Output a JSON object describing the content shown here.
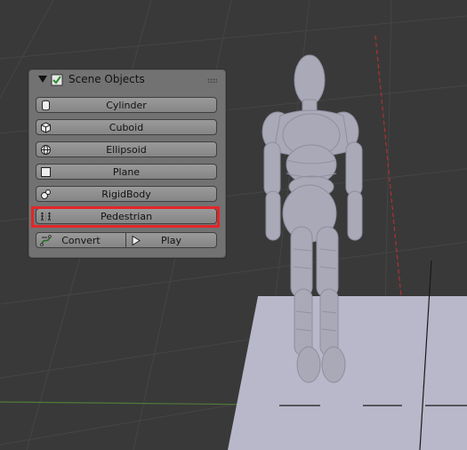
{
  "panel": {
    "title": "Scene Objects",
    "icons": {
      "header": "checkbox-tick-icon",
      "grip": "grip-dots-icon"
    },
    "items": [
      {
        "label": "Cylinder",
        "icon": "cylinder-icon"
      },
      {
        "label": "Cuboid",
        "icon": "cube-icon"
      },
      {
        "label": "Ellipsoid",
        "icon": "sphere-icon"
      },
      {
        "label": "Plane",
        "icon": "plane-icon"
      },
      {
        "label": "RigidBody",
        "icon": "rigidbody-icon"
      },
      {
        "label": "Pedestrian",
        "icon": "pedestrian-icon",
        "highlighted": true
      }
    ],
    "convert_label": "Convert",
    "play_label": "Play"
  },
  "viewport": {
    "highlight_color": "#e3262a",
    "background_color": "#3a3a3a",
    "ground_color": "#b7b7c9",
    "model_color": "#a9a9b8"
  }
}
